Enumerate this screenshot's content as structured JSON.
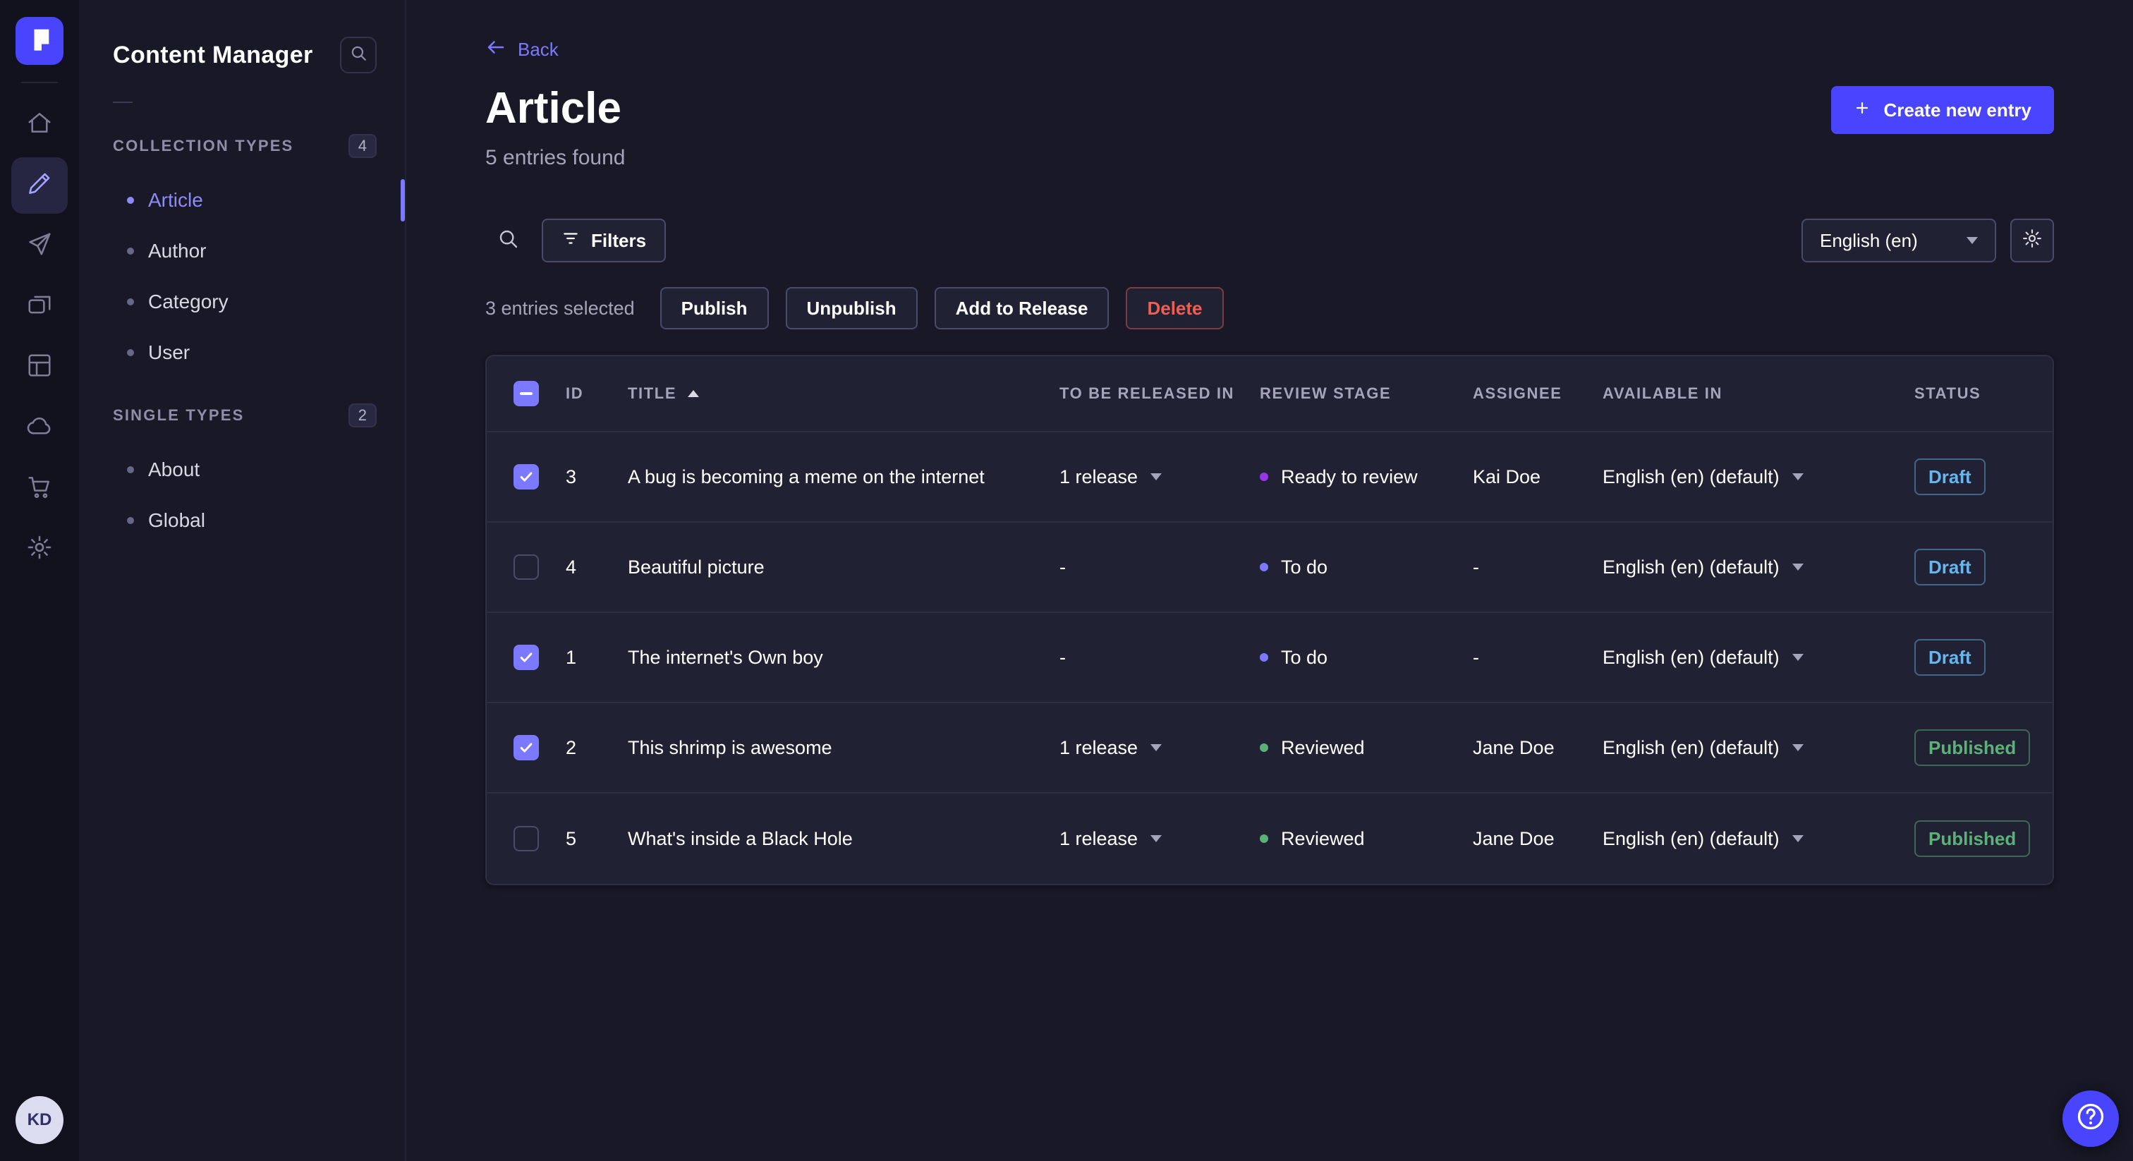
{
  "colors": {
    "primary": "#4945ff",
    "link": "#7b79ff",
    "success": "#5cb176",
    "danger": "#ee5e52",
    "draft": "#66b7f1"
  },
  "rail": {
    "avatar_initials": "KD",
    "items": [
      {
        "icon": "home",
        "active": false
      },
      {
        "icon": "pen",
        "active": true
      },
      {
        "icon": "paper-plane",
        "active": false
      },
      {
        "icon": "media",
        "active": false
      },
      {
        "icon": "layout",
        "active": false
      },
      {
        "icon": "cloud",
        "active": false
      },
      {
        "icon": "cart",
        "active": false
      },
      {
        "icon": "gear",
        "active": false
      }
    ]
  },
  "sidebar": {
    "title": "Content Manager",
    "sections": [
      {
        "label": "COLLECTION TYPES",
        "badge": "4",
        "items": [
          {
            "label": "Article",
            "active": true
          },
          {
            "label": "Author",
            "active": false
          },
          {
            "label": "Category",
            "active": false
          },
          {
            "label": "User",
            "active": false
          }
        ]
      },
      {
        "label": "SINGLE TYPES",
        "badge": "2",
        "items": [
          {
            "label": "About",
            "active": false
          },
          {
            "label": "Global",
            "active": false
          }
        ]
      }
    ]
  },
  "header": {
    "back_label": "Back",
    "title": "Article",
    "subtitle": "5 entries found",
    "create_button_label": "Create new entry"
  },
  "toolbar": {
    "filters_label": "Filters",
    "locale_value": "English (en)"
  },
  "selection": {
    "summary": "3 entries selected",
    "actions": [
      {
        "label": "Publish",
        "variant": "neutral"
      },
      {
        "label": "Unpublish",
        "variant": "neutral"
      },
      {
        "label": "Add to Release",
        "variant": "neutral"
      },
      {
        "label": "Delete",
        "variant": "danger"
      }
    ]
  },
  "table": {
    "header_checkbox": "indeterminate",
    "columns": [
      {
        "label": "ID",
        "sorted": false
      },
      {
        "label": "TITLE",
        "sorted": true
      },
      {
        "label": "TO BE RELEASED IN",
        "sorted": false
      },
      {
        "label": "REVIEW STAGE",
        "sorted": false
      },
      {
        "label": "ASSIGNEE",
        "sorted": false
      },
      {
        "label": "AVAILABLE IN",
        "sorted": false
      },
      {
        "label": "STATUS",
        "sorted": false
      }
    ],
    "rows": [
      {
        "checked": true,
        "id": "3",
        "title": "A bug is becoming a meme on the internet",
        "release": "1 release",
        "release_dropdown": true,
        "stage": {
          "label": "Ready to review",
          "color": "#9736e8"
        },
        "assignee": "Kai Doe",
        "available_in": "English (en) (default)",
        "status": "Draft"
      },
      {
        "checked": false,
        "id": "4",
        "title": "Beautiful picture",
        "release": "-",
        "release_dropdown": false,
        "stage": {
          "label": "To do",
          "color": "#7b79ff"
        },
        "assignee": "-",
        "available_in": "English (en) (default)",
        "status": "Draft"
      },
      {
        "checked": true,
        "id": "1",
        "title": "The internet's Own boy",
        "release": "-",
        "release_dropdown": false,
        "stage": {
          "label": "To do",
          "color": "#7b79ff"
        },
        "assignee": "-",
        "available_in": "English (en) (default)",
        "status": "Draft"
      },
      {
        "checked": true,
        "id": "2",
        "title": "This shrimp is awesome",
        "release": "1 release",
        "release_dropdown": true,
        "stage": {
          "label": "Reviewed",
          "color": "#5cb176"
        },
        "assignee": "Jane Doe",
        "available_in": "English (en) (default)",
        "status": "Published"
      },
      {
        "checked": false,
        "id": "5",
        "title": "What's inside a Black Hole",
        "release": "1 release",
        "release_dropdown": true,
        "stage": {
          "label": "Reviewed",
          "color": "#5cb176"
        },
        "assignee": "Jane Doe",
        "available_in": "English (en) (default)",
        "status": "Published"
      }
    ]
  }
}
